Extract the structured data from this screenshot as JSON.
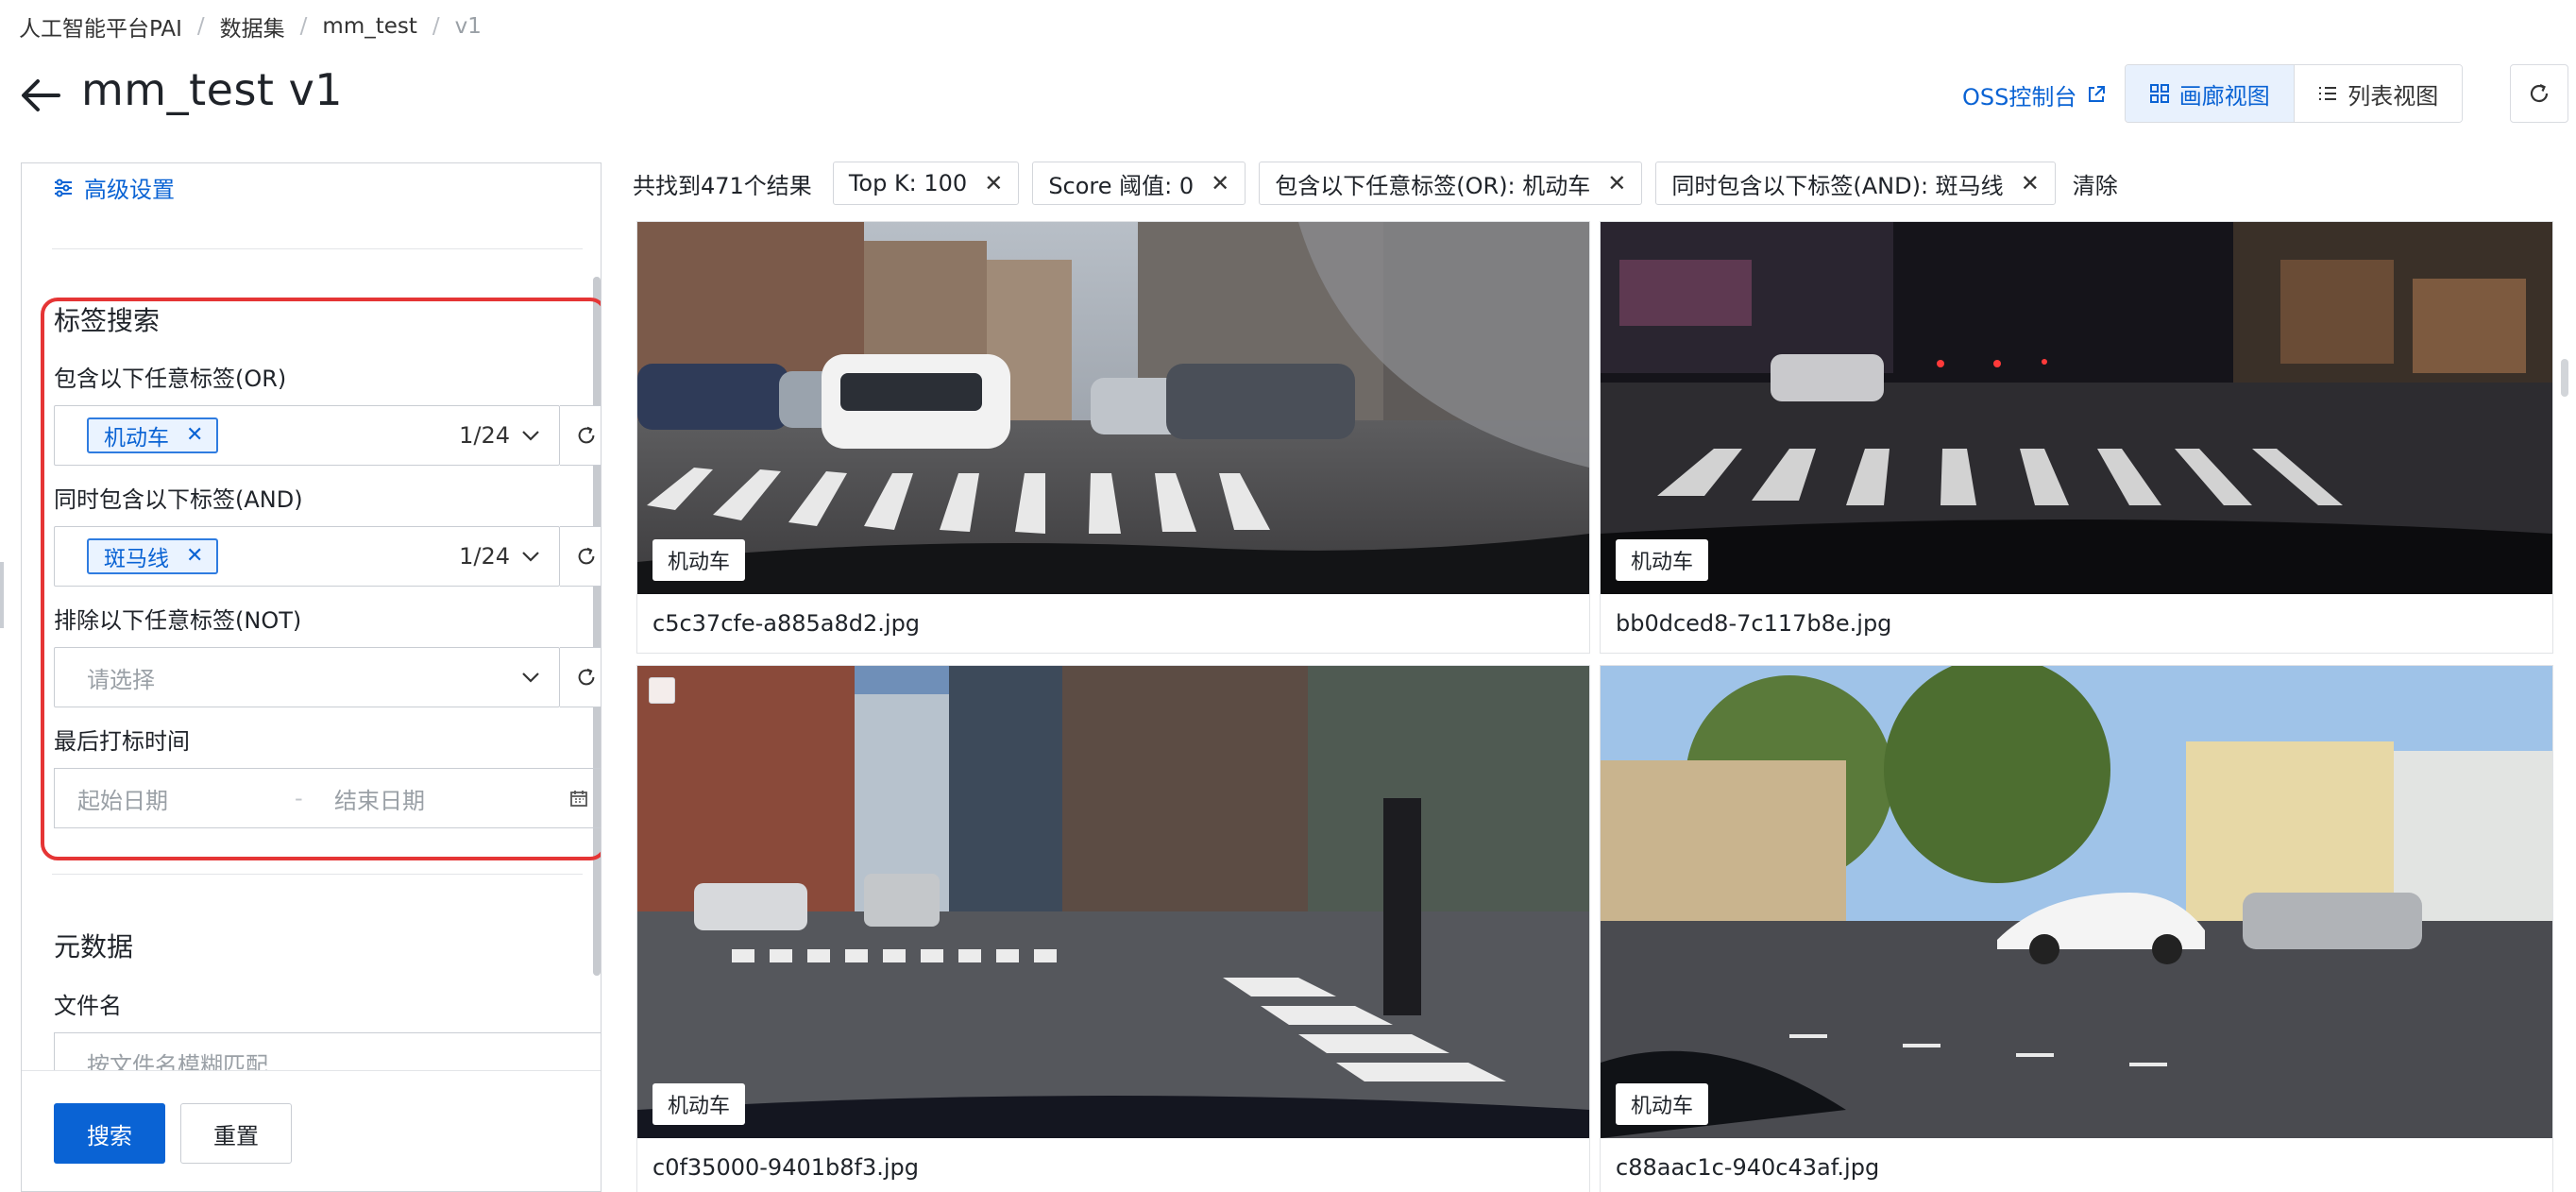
{
  "breadcrumb": [
    "人工智能平台PAI",
    "数据集",
    "mm_test",
    "v1"
  ],
  "header": {
    "title": "mm_test v1",
    "oss_link": "OSS控制台",
    "views": [
      "画廊视图",
      "列表视图"
    ]
  },
  "left_panel": {
    "advanced_settings": "高级设置",
    "tag_search": {
      "title": "标签搜索",
      "or_label": "包含以下任意标签(OR)",
      "or_tag": "机动车",
      "or_count": "1/24",
      "and_label": "同时包含以下标签(AND)",
      "and_tag": "斑马线",
      "and_count": "1/24",
      "not_label": "排除以下任意标签(NOT)",
      "not_placeholder": "请选择",
      "time_label": "最后打标时间",
      "start_placeholder": "起始日期",
      "date_sep": "-",
      "end_placeholder": "结束日期"
    },
    "metadata": {
      "title": "元数据",
      "filename_label": "文件名",
      "filename_placeholder": "按文件名模糊匹配"
    },
    "search_button": "搜索",
    "reset_button": "重置"
  },
  "filters": {
    "result_count": "共找到471个结果",
    "chips": [
      "Top K: 100",
      "Score 阈值: 0",
      "包含以下任意标签(OR): 机动车",
      "同时包含以下标签(AND): 斑马线"
    ],
    "clear": "清除"
  },
  "gallery": [
    {
      "filename": "c5c37cfe-a885a8d2.jpg",
      "label": "机动车"
    },
    {
      "filename": "bb0dced8-7c117b8e.jpg",
      "label": "机动车"
    },
    {
      "filename": "c0f35000-9401b8f3.jpg",
      "label": "机动车"
    },
    {
      "filename": "c88aac1c-940c43af.jpg",
      "label": "机动车"
    }
  ],
  "colors": {
    "accent": "#0a63d4",
    "highlight": "#e53535"
  }
}
